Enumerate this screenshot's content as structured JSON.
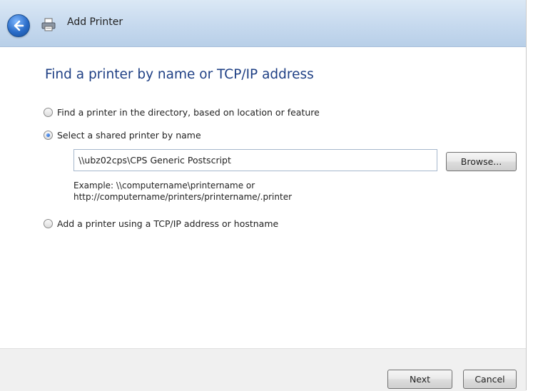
{
  "window": {
    "title": "Add Printer",
    "back_icon": "back-arrow-icon",
    "app_icon": "printer-icon"
  },
  "page": {
    "heading": "Find a printer by name or TCP/IP address"
  },
  "options": [
    {
      "label": "Find a printer in the directory, based on location or feature",
      "checked": false
    },
    {
      "label": "Select a shared printer by name",
      "checked": true
    },
    {
      "label": "Add a printer using a TCP/IP address or hostname",
      "checked": false
    }
  ],
  "shared_printer": {
    "value": "\\\\ubz02cps\\CPS Generic Postscript",
    "browse_label": "Browse...",
    "example_line1": "Example: \\\\computername\\printername or",
    "example_line2": "http://computername/printers/printername/.printer"
  },
  "footer": {
    "next_label": "Next",
    "cancel_label": "Cancel"
  },
  "colors": {
    "heading": "#1e3f84",
    "header_bg": "#c6d9ee"
  }
}
